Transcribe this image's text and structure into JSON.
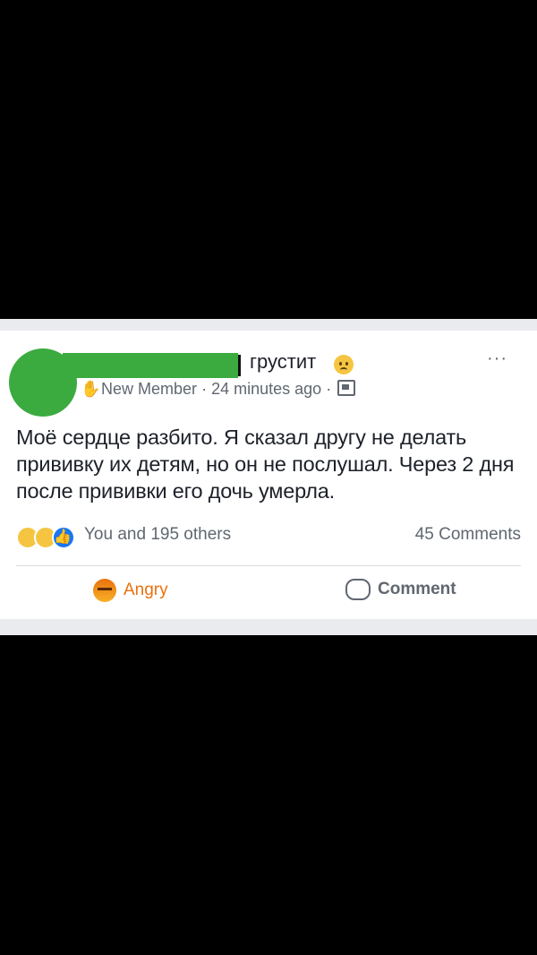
{
  "post": {
    "feeling": "грустит",
    "badge": "New Member",
    "time": "24 minutes ago",
    "meta_sep": "·",
    "more": "···",
    "text": "Моё сердце разбито. Я сказал другу не делать прививку их детям, но он не послушал. Через 2 дня после прививки его дочь умерла.",
    "reactions_summary": "You and 195 others",
    "comments_count": "45 Comments",
    "angry_label": "Angry",
    "comment_label": "Comment"
  },
  "colors": {
    "censor_green": "#3bab3f",
    "angry_orange": "#e9710f",
    "like_blue": "#1877f2"
  },
  "icons": [
    "sad-face-icon",
    "waving-hand-icon",
    "group-icon",
    "sad-reaction-icon",
    "wow-reaction-icon",
    "like-reaction-icon",
    "angry-reaction-icon",
    "comment-icon",
    "more-options-icon"
  ]
}
